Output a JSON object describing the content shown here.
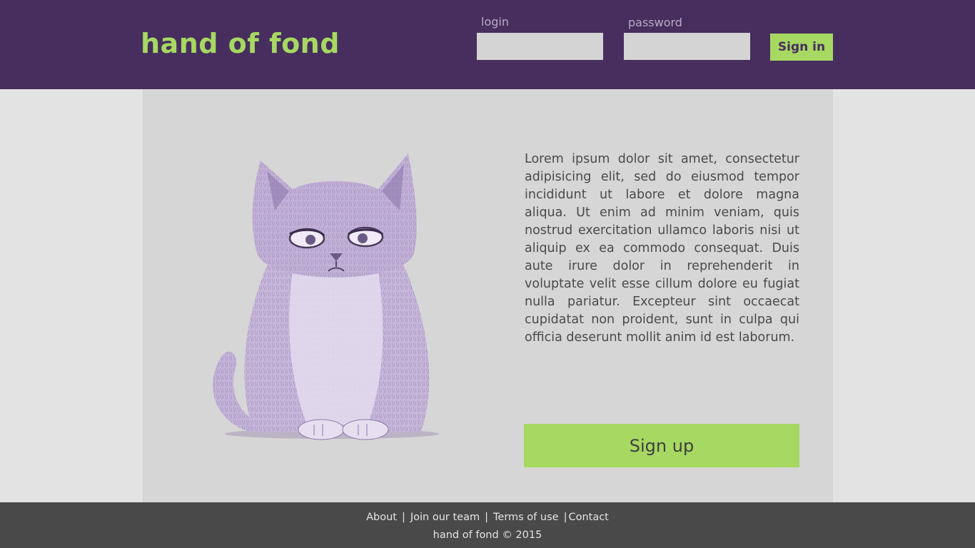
{
  "header": {
    "logo": "hand of fond",
    "login_label": "login",
    "password_label": "password",
    "login_value": "",
    "password_value": "",
    "signin_label": "Sign in"
  },
  "main": {
    "description": "Lorem ipsum dolor sit amet, consectetur adipisicing elit, sed do eiusmod tempor incididunt ut labore et dolore magna aliqua. Ut enim ad minim veniam, quis nostrud exercitation ullamco laboris nisi ut aliquip ex ea commodo consequat. Duis aute irure dolor in reprehenderit in voluptate velit esse cillum dolore eu fugiat nulla pariatur. Excepteur sint occaecat cupidatat non proident, sunt in culpa qui officia deserunt mollit anim id est laborum.",
    "signup_label": "Sign up",
    "image_icon": "cat-illustration"
  },
  "footer": {
    "links": [
      "About",
      "Join our team",
      "Terms of use",
      "Contact"
    ],
    "separator": "|",
    "copyright": "hand of fond © 2015"
  },
  "colors": {
    "header_bg": "#472e5e",
    "accent": "#a6d862",
    "page_bg": "#e3e3e3",
    "content_bg": "#d6d6d6",
    "footer_bg": "#494949"
  }
}
